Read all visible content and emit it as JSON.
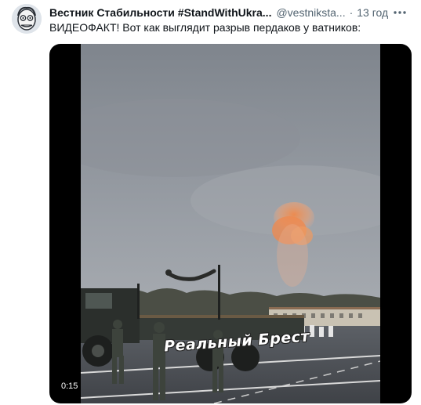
{
  "tweet": {
    "display_name": "Вестник Стабильности #StandWithUkra...",
    "handle": "@vestniksta...",
    "separator": "·",
    "time": "13 год",
    "text": "ВИДЕОФАКТ! Вот как выглядит разрыв пердаков у ватников:"
  },
  "media": {
    "caption": "Реальный Брест",
    "duration": "0:15"
  },
  "icons": {
    "more": "more-icon",
    "avatar": "avatar"
  },
  "colors": {
    "text_primary": "#0f1419",
    "text_secondary": "#536471",
    "smoke": "#f08a4b"
  }
}
